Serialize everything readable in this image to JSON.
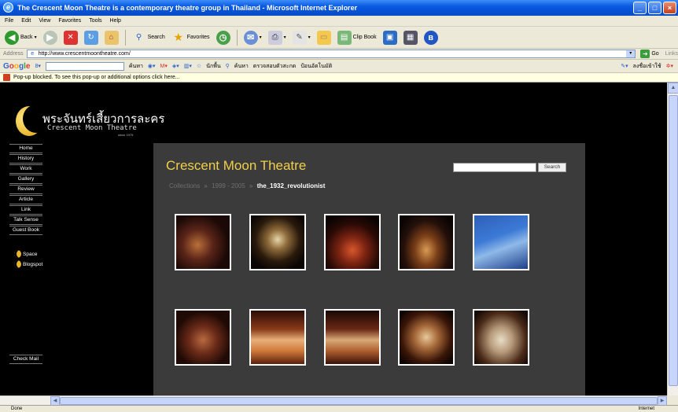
{
  "window": {
    "title": "The Crescent Moon Theatre is a contemporary theatre group in Thailand - Microsoft Internet Explorer",
    "minimize": "_",
    "maximize": "□",
    "close": "×"
  },
  "menu": [
    "File",
    "Edit",
    "View",
    "Favorites",
    "Tools",
    "Help"
  ],
  "toolbar": {
    "back": "Back",
    "search": "Search",
    "favorites": "Favorites",
    "clipbook": "Clip Book"
  },
  "address": {
    "label": "Address",
    "url": "http://www.crescentmoontheatre.com/",
    "go": "Go",
    "links": "Links"
  },
  "googlebar": {
    "g1": "ค้นหา",
    "g2": "นักพื้น",
    "g3": "ค้นหา",
    "g4": "ตรวจสอบตัวสะกด",
    "g5": "ป้อนอัตโนมัติ",
    "g6": "ลงชื่อเข้าใช้"
  },
  "popup": {
    "text": "Pop-up blocked. To see this pop-up or additional options click here..."
  },
  "site": {
    "logo_thai": "พระจันทร์เสี้ยวการละคร",
    "logo_eng": "Crescent Moon Theatre",
    "logo_since": "since 1979",
    "nav": [
      "Home",
      "History",
      "Work",
      "Gallery",
      "Review",
      "Article",
      "Link",
      "Talk Sense",
      "Guest Book"
    ],
    "blog_links": [
      "Space",
      "Blogspot"
    ],
    "check_mail": "Check Mail",
    "title": "Crescent Moon Theatre",
    "search_button": "Search",
    "breadcrumb": {
      "part1": "Collections",
      "part2": "1999 - 2005",
      "current": "the_1932_revolutionist",
      "separator": "»"
    }
  },
  "status": {
    "left": "Done",
    "right": "Internet"
  },
  "colors": {
    "title_gold": "#f0cf4a",
    "panel": "#3b3b3b",
    "background": "#000000"
  }
}
